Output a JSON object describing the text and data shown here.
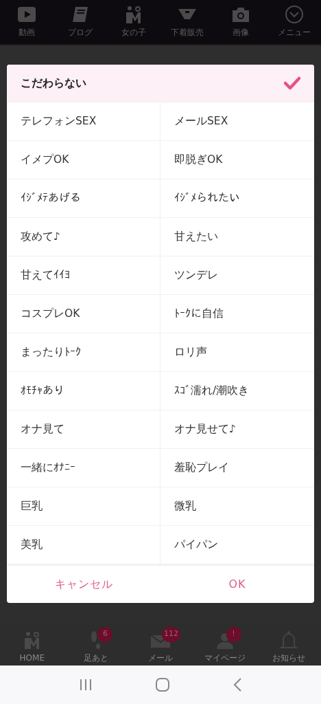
{
  "top_nav": [
    {
      "label": "動画"
    },
    {
      "label": "ブログ"
    },
    {
      "label": "女の子"
    },
    {
      "label": "下着販売"
    },
    {
      "label": "画像"
    },
    {
      "label": "メニュー"
    }
  ],
  "dialog": {
    "any_option": {
      "label": "こだわらない",
      "selected": true
    },
    "options": [
      {
        "label": "テレフォンSEX",
        "selected": false
      },
      {
        "label": "メールSEX",
        "selected": false
      },
      {
        "label": "イメプOK",
        "selected": false
      },
      {
        "label": "即脱ぎOK",
        "selected": false
      },
      {
        "label": "ｲｼﾞﾒﾃあげる",
        "selected": false
      },
      {
        "label": "ｲｼﾞﾒられたい",
        "selected": false
      },
      {
        "label": "攻めて♪",
        "selected": false
      },
      {
        "label": "甘えたい",
        "selected": false
      },
      {
        "label": "甘えてｲｲﾖ",
        "selected": false
      },
      {
        "label": "ツンデレ",
        "selected": false
      },
      {
        "label": "コスプレOK",
        "selected": false
      },
      {
        "label": "ﾄｰｸに自信",
        "selected": false
      },
      {
        "label": "まったりﾄｰｸ",
        "selected": false
      },
      {
        "label": "ロリ声",
        "selected": false
      },
      {
        "label": "ｵﾓﾁｬあり",
        "selected": false
      },
      {
        "label": "ｽｺﾞ濡れ/潮吹き",
        "selected": false
      },
      {
        "label": "オナ見て",
        "selected": false
      },
      {
        "label": "オナ見せて♪",
        "selected": false
      },
      {
        "label": "一緒にｵﾅﾆｰ",
        "selected": false
      },
      {
        "label": "羞恥プレイ",
        "selected": false
      },
      {
        "label": "巨乳",
        "selected": false
      },
      {
        "label": "微乳",
        "selected": false
      },
      {
        "label": "美乳",
        "selected": false
      },
      {
        "label": "パイパン",
        "selected": false
      }
    ],
    "buttons": [
      {
        "label": "キャンセル"
      },
      {
        "label": "OK"
      }
    ]
  },
  "bottom_nav": [
    {
      "label": "HOME"
    },
    {
      "label": "足あと",
      "badge": "6"
    },
    {
      "label": "メール",
      "badge": "112"
    },
    {
      "label": "マイページ",
      "badge": "!"
    },
    {
      "label": "お知らせ"
    }
  ]
}
